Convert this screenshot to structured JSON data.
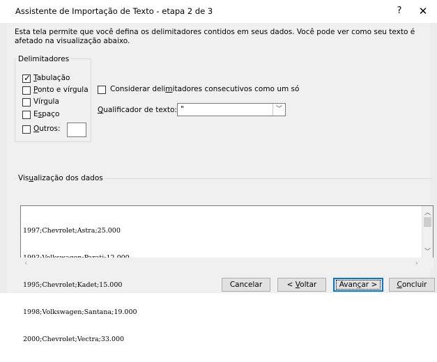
{
  "window": {
    "title": "Assistente de Importação de Texto - etapa 2 de 3",
    "help_label": "?",
    "close_label": "✕"
  },
  "description": "Esta tela permite que você defina os delimitadores contidos em seus dados. Você pode ver como seu texto é afetado na visualização abaixo.",
  "delimiters": {
    "group_title": "Delimitadores",
    "items": [
      {
        "label_pre": "",
        "label_u": "T",
        "label_post": "abulação",
        "checked": true
      },
      {
        "label_pre": "",
        "label_u": "P",
        "label_post": "onto e vírgula",
        "checked": false
      },
      {
        "label_pre": "Vír",
        "label_u": "g",
        "label_post": "ula",
        "checked": false
      },
      {
        "label_pre": "E",
        "label_u": "s",
        "label_post": "paço",
        "checked": false
      },
      {
        "label_pre": "",
        "label_u": "O",
        "label_post": "utros:",
        "checked": false
      }
    ],
    "outros_value": ""
  },
  "consecutive": {
    "label_pre": "Considerar deli",
    "label_u": "m",
    "label_post": "itadores consecutivos como um só",
    "checked": false
  },
  "qualifier": {
    "label_pre": "",
    "label_u": "Q",
    "label_post": "ualificador de texto:",
    "value": "\""
  },
  "preview": {
    "title_pre": "Vis",
    "title_u": "u",
    "title_post": "alização dos dados",
    "lines": [
      "1997;Chevrolet;Astra;25.000",
      "1993;Volkswagen;Parati;12.000",
      "1995;Chevrolet;Kadet;15.000",
      "1998;Volkswagen;Santana;19.000",
      "2000;Chevrolet;Vectra;33.000"
    ]
  },
  "buttons": {
    "cancel": "Cancelar",
    "back_pre": "< ",
    "back_u": "V",
    "back_post": "oltar",
    "next_pre": "Avan",
    "next_u": "ç",
    "next_post": "ar >",
    "finish_pre": "",
    "finish_u": "C",
    "finish_post": "oncluir"
  }
}
